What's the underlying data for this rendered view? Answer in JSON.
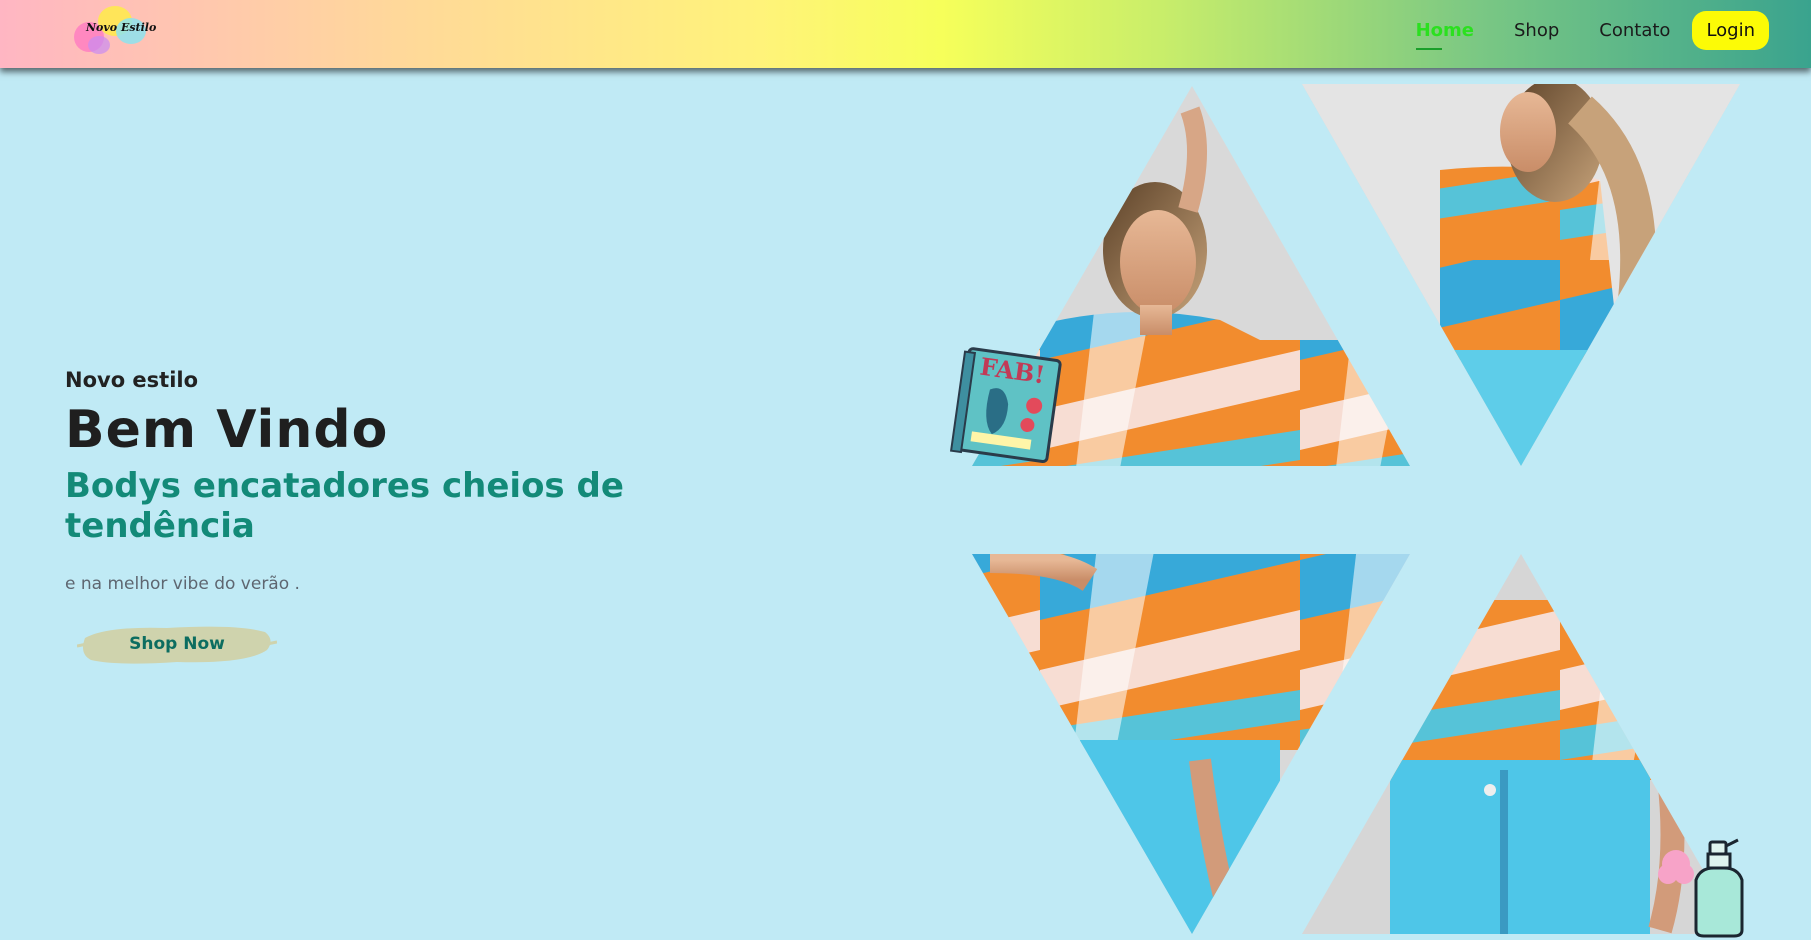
{
  "header": {
    "logo_text": "Novo Estilo",
    "nav": [
      {
        "label": "Home",
        "active": true
      },
      {
        "label": "Shop",
        "active": false
      },
      {
        "label": "Contato",
        "active": false
      }
    ],
    "login_label": "Login"
  },
  "hero": {
    "kicker": "Novo estilo",
    "title": "Bem Vindo",
    "subtitle": "Bodys encatadores cheios de tendência",
    "description": "e na melhor vibe do verão .",
    "cta_label": "Shop Now"
  },
  "stickers": {
    "book_text": "FAB!"
  },
  "colors": {
    "background": "#c0eaf5",
    "accent_teal": "#138a78",
    "login_yellow": "#fcfb06",
    "active_nav_green": "#2be01f",
    "cta_brush": "#cfd3ad"
  }
}
